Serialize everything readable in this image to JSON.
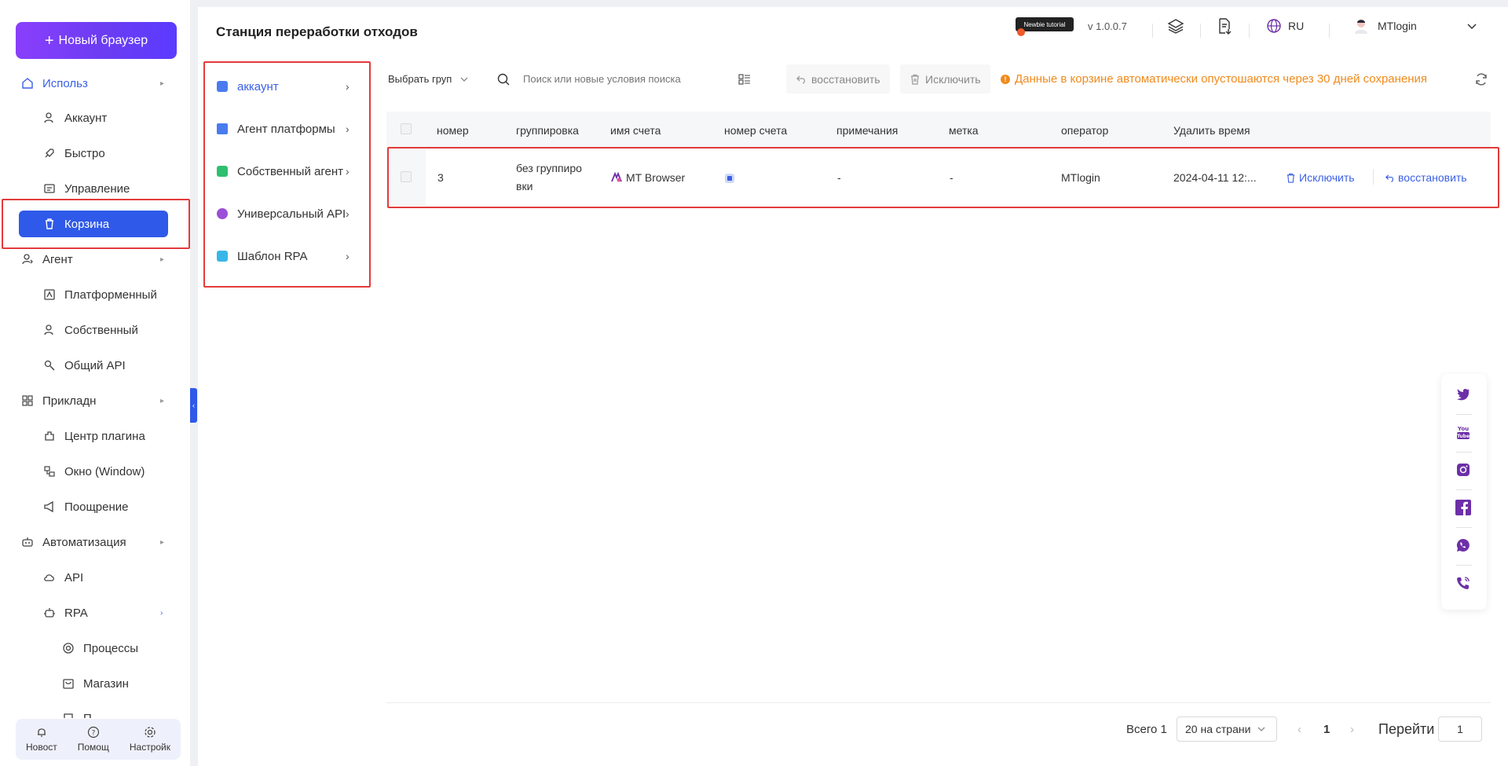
{
  "sidebar": {
    "new_browser": "Новый браузер",
    "items": [
      {
        "label": "Использ",
        "icon": "home-icon"
      },
      {
        "label": "Аккаунт",
        "icon": "user-icon"
      },
      {
        "label": "Быстро",
        "icon": "rocket-icon"
      },
      {
        "label": "Управление",
        "icon": "manage-icon"
      },
      {
        "label": "Корзина",
        "icon": "trash-icon"
      },
      {
        "label": "Агент",
        "icon": "agent-icon"
      },
      {
        "label": "Платформенный",
        "icon": "platform-icon"
      },
      {
        "label": "Собственный",
        "icon": "user-icon"
      },
      {
        "label": "Общий API",
        "icon": "api-icon"
      },
      {
        "label": "Прикладн",
        "icon": "apps-icon"
      },
      {
        "label": "Центр плагина",
        "icon": "plugin-icon"
      },
      {
        "label": "Окно (Window)",
        "icon": "window-icon"
      },
      {
        "label": "Поощрение",
        "icon": "megaphone-icon"
      },
      {
        "label": "Автоматизация",
        "icon": "robot-icon"
      },
      {
        "label": "API",
        "icon": "cloud-icon"
      },
      {
        "label": "RPA",
        "icon": "rpa-icon"
      },
      {
        "label": "Процессы",
        "icon": "process-icon"
      },
      {
        "label": "Магазин",
        "icon": "store-icon"
      },
      {
        "label": "П",
        "icon": "doc-icon"
      }
    ],
    "bottom": [
      {
        "label": "Новост",
        "icon": "bell-icon"
      },
      {
        "label": "Помощ",
        "icon": "help-icon"
      },
      {
        "label": "Настройк",
        "icon": "gear-icon"
      }
    ]
  },
  "header": {
    "title": "Станция переработки отходов",
    "tutorial": "Newbie tutorial",
    "version": "v 1.0.0.7",
    "language": "RU",
    "user": "MTlogin"
  },
  "categories": [
    {
      "label": "аккаунт",
      "color": "#4a7cf0"
    },
    {
      "label": "Агент платформы",
      "color": "#4a7cf0"
    },
    {
      "label": "Собственный агент",
      "color": "#2fbf71"
    },
    {
      "label": "Универсальный API",
      "color": "#9b4fd8"
    },
    {
      "label": "Шаблон RPA",
      "color": "#39b6e8"
    }
  ],
  "toolbar": {
    "group_select": "Выбрать груп",
    "search_placeholder": "Поиск или новые условия поиска",
    "restore": "восстановить",
    "exclude": "Исключить",
    "notice": "Данные в корзине автоматически опустошаются через 30 дней сохранения"
  },
  "table": {
    "columns": [
      "номер",
      "группировка",
      "имя счета",
      "номер счета",
      "примечания",
      "метка",
      "оператор",
      "Удалить время"
    ],
    "rows": [
      {
        "number": "3",
        "group_line1": "без группиро",
        "group_line2": "вки",
        "account_name": "MT Browser",
        "notes": "-",
        "tag": "-",
        "operator": "MTlogin",
        "deleted_at": "2024-04-11 12:...",
        "exclude": "Исключить",
        "restore": "восстановить"
      }
    ]
  },
  "pager": {
    "total": "Всего 1",
    "per_page": "20 на страни",
    "page": "1",
    "goto": "Перейти",
    "goto_value": "1"
  },
  "colors": {
    "accent": "#2f59e8",
    "warning": "#f08a1c",
    "highlight": "#e33b3b",
    "brand_purple": "#6d2fa8"
  }
}
